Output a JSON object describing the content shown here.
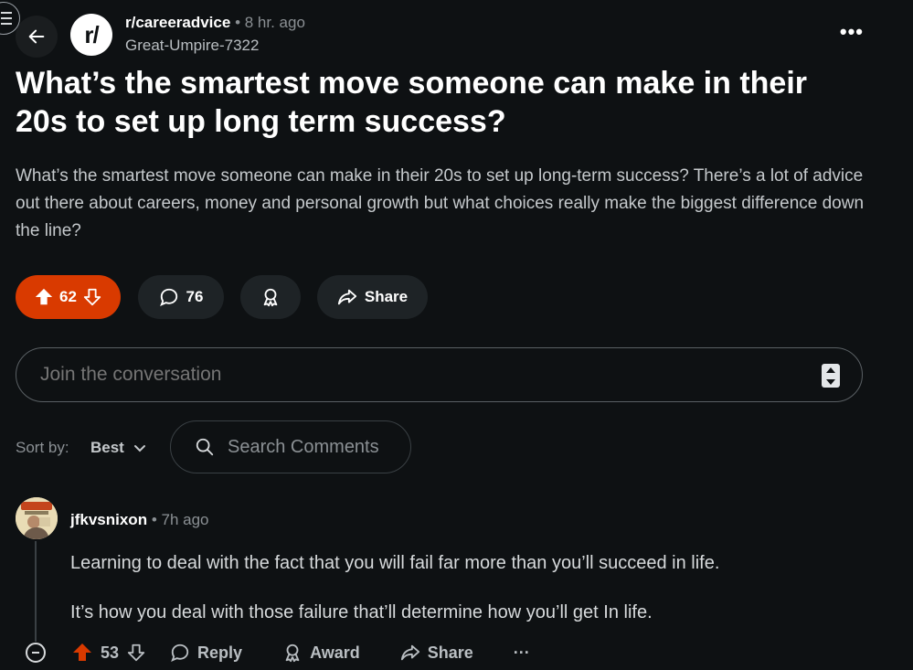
{
  "header": {
    "subreddit": "r/careeradvice",
    "separator": "•",
    "post_age": "8 hr. ago",
    "author": "Great-Umpire-7322",
    "sub_avatar_text": "r/",
    "more_icon": "more-horizontal-icon",
    "more_label": "•••"
  },
  "post": {
    "title": "What’s the smartest move someone can make in their 20s to set up long term success?",
    "body": "What’s the smartest move someone can make in their 20s to set up long-term success? There’s a lot of advice out there about careers, money and personal growth but what choices really make the biggest difference down the line?",
    "vote_count": "62",
    "comment_count": "76",
    "share_label": "Share"
  },
  "composer": {
    "placeholder": "Join the conversation"
  },
  "sort": {
    "label": "Sort by:",
    "value": "Best"
  },
  "search": {
    "placeholder": "Search Comments"
  },
  "comment": {
    "author": "jfkvsnixon",
    "separator": "•",
    "age": "7h ago",
    "paragraphs": [
      "Learning to deal with the fact that you will fail far more than you’ll succeed in life.",
      "It’s how you deal with those failure that’ll determine how you’ll get In life."
    ],
    "vote_count": "53",
    "reply_label": "Reply",
    "award_label": "Award",
    "share_label": "Share",
    "more_label": "···"
  },
  "colors": {
    "background": "#0e1113",
    "upvote_accent": "#d93a00",
    "pill_bg": "#1e2326"
  }
}
